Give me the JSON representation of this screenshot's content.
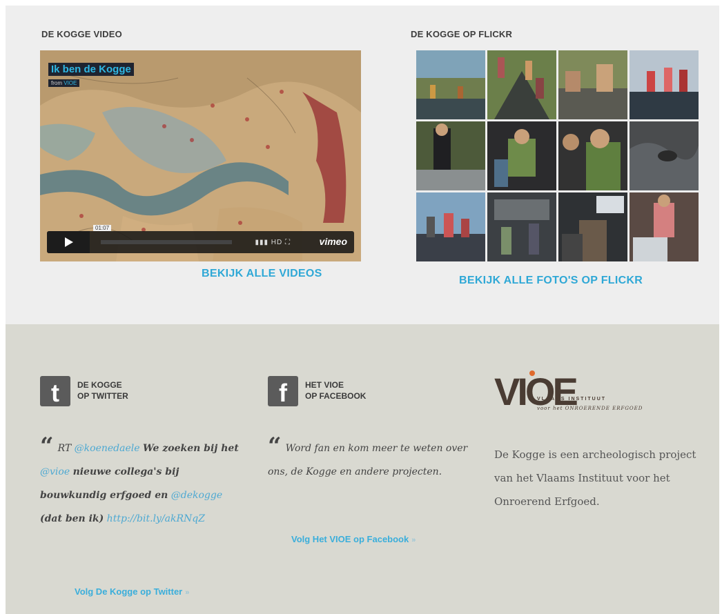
{
  "video_section": {
    "title": "DE KOGGE VIDEO",
    "video_title": "Ik ben de Kogge",
    "from_prefix": "from",
    "from_name": "VIOE",
    "duration": "01:07",
    "player_icons": "▮▮▮ HD ⛶",
    "player_logo": "vimeo",
    "view_all": "BEKIJK ALLE VIDEOS"
  },
  "flickr_section": {
    "title": "DE KOGGE OP FLICKR",
    "view_all": "BEKIJK ALLE FOTO'S OP FLICKR"
  },
  "twitter": {
    "icon": "twitter-icon",
    "label_line1": "DE KOGGE",
    "label_line2": "OP TWITTER",
    "tweet_rt": "RT",
    "tweet_user": "@koenedaele",
    "tweet_part1": "We zoeken bij het",
    "tweet_mention1": "@vioe",
    "tweet_part2": "nieuwe collega's bij bouwkundig erfgoed en",
    "tweet_mention2": "@dekogge",
    "tweet_part3": "(dat ben ik)",
    "tweet_link": "http://bit.ly/akRNqZ",
    "follow": "Volg De Kogge op Twitter",
    "follow_arrow": "»"
  },
  "facebook": {
    "icon": "facebook-icon",
    "label_line1": "HET VIOE",
    "label_line2": "OP FACEBOOK",
    "quote": "Word fan en kom meer te weten over ons, de Kogge en andere projecten.",
    "follow": "Volg Het VIOE op Facebook",
    "follow_arrow": "»"
  },
  "vioe": {
    "logo_text": "VIOE",
    "logo_line1": "VLAAMS INSTITUUT",
    "logo_line2": "voor het ONROERENDE ERFGOED",
    "about": "De Kogge is een archeologisch project van het Vlaams Instituut voor het Onroerend Erfgoed."
  }
}
